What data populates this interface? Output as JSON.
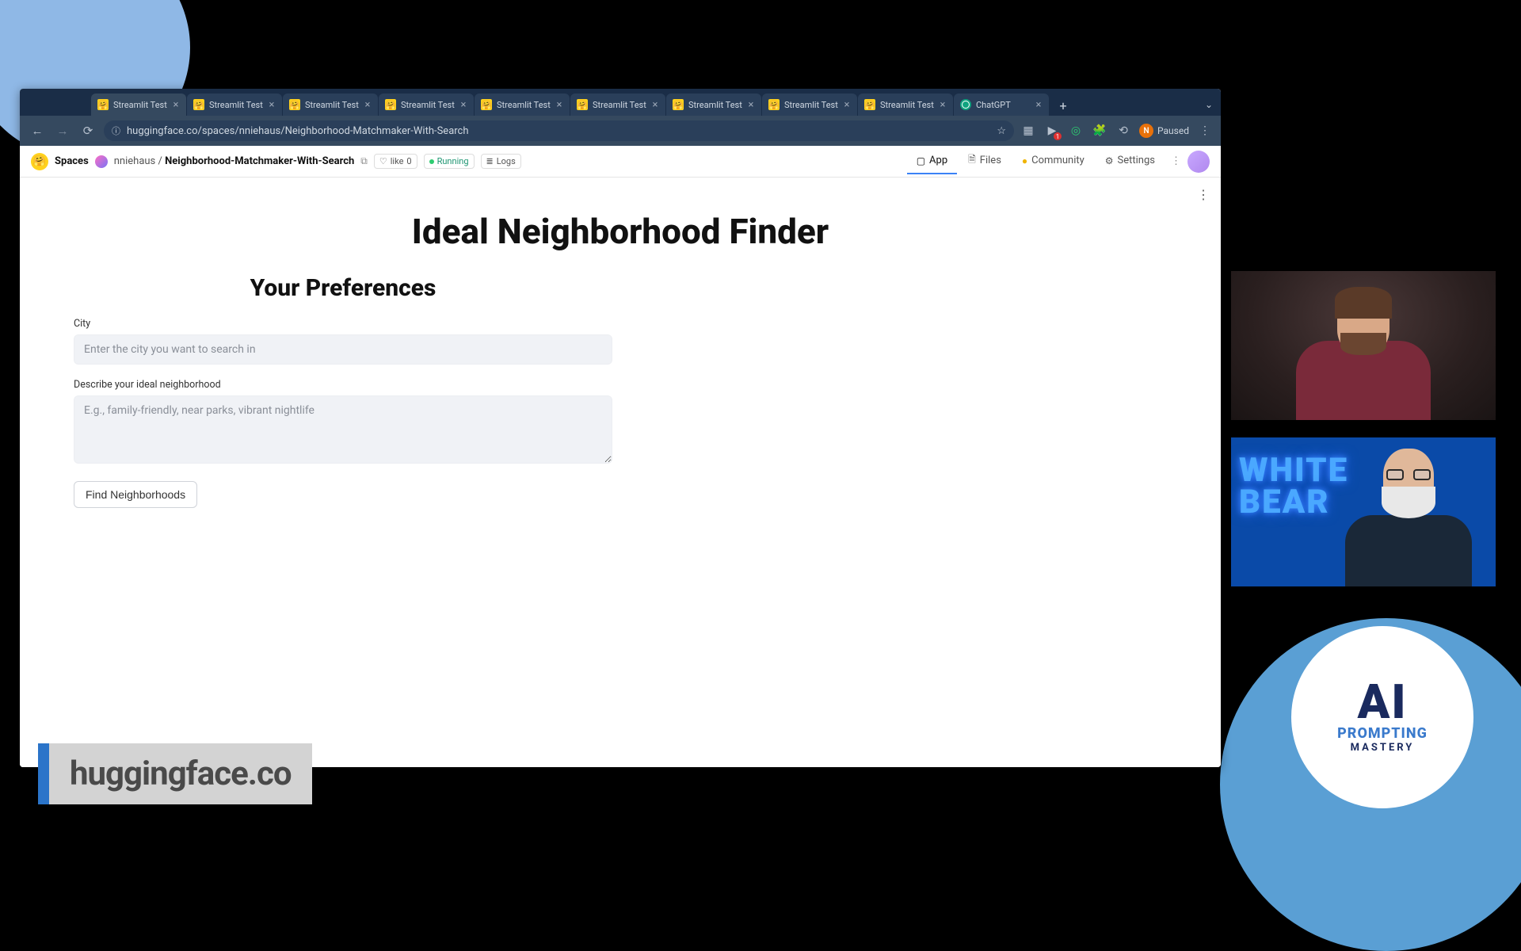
{
  "tabs": [
    {
      "label": "Streamlit Test",
      "icon": "hf"
    },
    {
      "label": "Streamlit Test",
      "icon": "hf"
    },
    {
      "label": "Streamlit Test",
      "icon": "hf"
    },
    {
      "label": "Streamlit Test",
      "icon": "hf"
    },
    {
      "label": "Streamlit Test",
      "icon": "hf"
    },
    {
      "label": "Streamlit Test",
      "icon": "hf"
    },
    {
      "label": "Streamlit Test",
      "icon": "hf"
    },
    {
      "label": "Streamlit Test",
      "icon": "hf"
    },
    {
      "label": "Streamlit Test",
      "icon": "hf"
    },
    {
      "label": "ChatGPT",
      "icon": "cg"
    }
  ],
  "address": {
    "url": "huggingface.co/spaces/nniehaus/Neighborhood-Matchmaker-With-Search",
    "profile_initial": "N",
    "profile_status": "Paused"
  },
  "hf": {
    "section": "Spaces",
    "user": "nniehaus",
    "repo": "Neighborhood-Matchmaker-With-Search",
    "like_label": "like",
    "like_count": "0",
    "status": "Running",
    "logs": "Logs",
    "nav": {
      "app": "App",
      "files": "Files",
      "community": "Community",
      "settings": "Settings"
    }
  },
  "app": {
    "title": "Ideal Neighborhood Finder",
    "prefs_heading": "Your Preferences",
    "city_label": "City",
    "city_placeholder": "Enter the city you want to search in",
    "desc_label": "Describe your ideal neighborhood",
    "desc_placeholder": "E.g., family-friendly, near parks, vibrant nightlife",
    "button": "Find Neighborhoods"
  },
  "lower_third": "huggingface.co",
  "badge": {
    "line1": "AI",
    "line2": "PROMPTING",
    "line3": "MASTERY"
  },
  "cam2_neon": "WHITE\nBEAR"
}
